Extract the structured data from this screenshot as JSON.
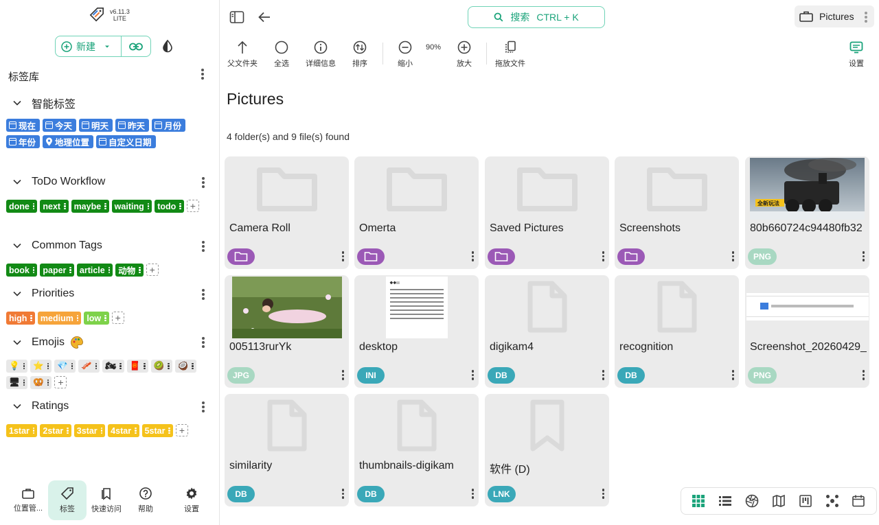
{
  "app": {
    "version": "v6.11.3",
    "edition": "LITE"
  },
  "sidebar": {
    "new_label": "新建",
    "library_title": "标签库",
    "groups": [
      {
        "title": "智能标签"
      },
      {
        "title": "ToDo Workflow"
      },
      {
        "title": "Common Tags"
      },
      {
        "title": "Priorities"
      },
      {
        "title": "Emojis"
      },
      {
        "title": "Ratings"
      }
    ],
    "smart_tags": [
      "现在",
      "今天",
      "明天",
      "昨天",
      "月份",
      "年份",
      "地理位置",
      "自定义日期"
    ],
    "todo_tags": [
      "done",
      "next",
      "maybe",
      "waiting",
      "todo"
    ],
    "common_tags": [
      "book",
      "paper",
      "article",
      "动物"
    ],
    "priority_tags": [
      "high",
      "medium",
      "low"
    ],
    "emoji_tags": [
      "💡",
      "⭐",
      "💎",
      "🥓",
      "🏍",
      "🧧",
      "🥝",
      "🥥",
      "🖥",
      "🥨"
    ],
    "rating_tags": [
      "1star",
      "2star",
      "3star",
      "4star",
      "5star"
    ],
    "bottom_nav": [
      "位置管...",
      "标签",
      "快速访问",
      "帮助",
      "设置"
    ]
  },
  "main": {
    "search_label": "搜索",
    "search_shortcut": "CTRL + K",
    "location_name": "Pictures",
    "toolbar": {
      "parent": "父文件夹",
      "select_all": "全选",
      "details": "详细信息",
      "sort": "排序",
      "zoom_out": "缩小",
      "zoom_level": "90%",
      "zoom_in": "放大",
      "drop_files": "拖放文件",
      "settings": "设置"
    },
    "folder_title": "Pictures",
    "found_text": "4 folder(s) and 9 file(s) found",
    "entries": [
      {
        "name": "Camera Roll",
        "type": "folder"
      },
      {
        "name": "Omerta",
        "type": "folder"
      },
      {
        "name": "Saved Pictures",
        "type": "folder"
      },
      {
        "name": "Screenshots",
        "type": "folder"
      },
      {
        "name": "80b660724c94480fb32",
        "type": "PNG"
      },
      {
        "name": "005113rurYk",
        "type": "JPG"
      },
      {
        "name": "desktop",
        "type": "INI"
      },
      {
        "name": "digikam4",
        "type": "DB"
      },
      {
        "name": "recognition",
        "type": "DB"
      },
      {
        "name": "Screenshot_20260429_",
        "type": "PNG"
      },
      {
        "name": "similarity",
        "type": "DB"
      },
      {
        "name": "thumbnails-digikam",
        "type": "DB"
      },
      {
        "name": "软件 (D)",
        "type": "LNK"
      }
    ],
    "train_thumb_caption": "全新玩法",
    "desktop_thumb_text": "◆◆☒"
  },
  "colors": {
    "accent": "#1aa37a",
    "smart_tag": "#3b7ddd",
    "todo_tag": "#128a15",
    "folder_badge": "#9b59b6",
    "db_badge": "#3aa8b8"
  }
}
